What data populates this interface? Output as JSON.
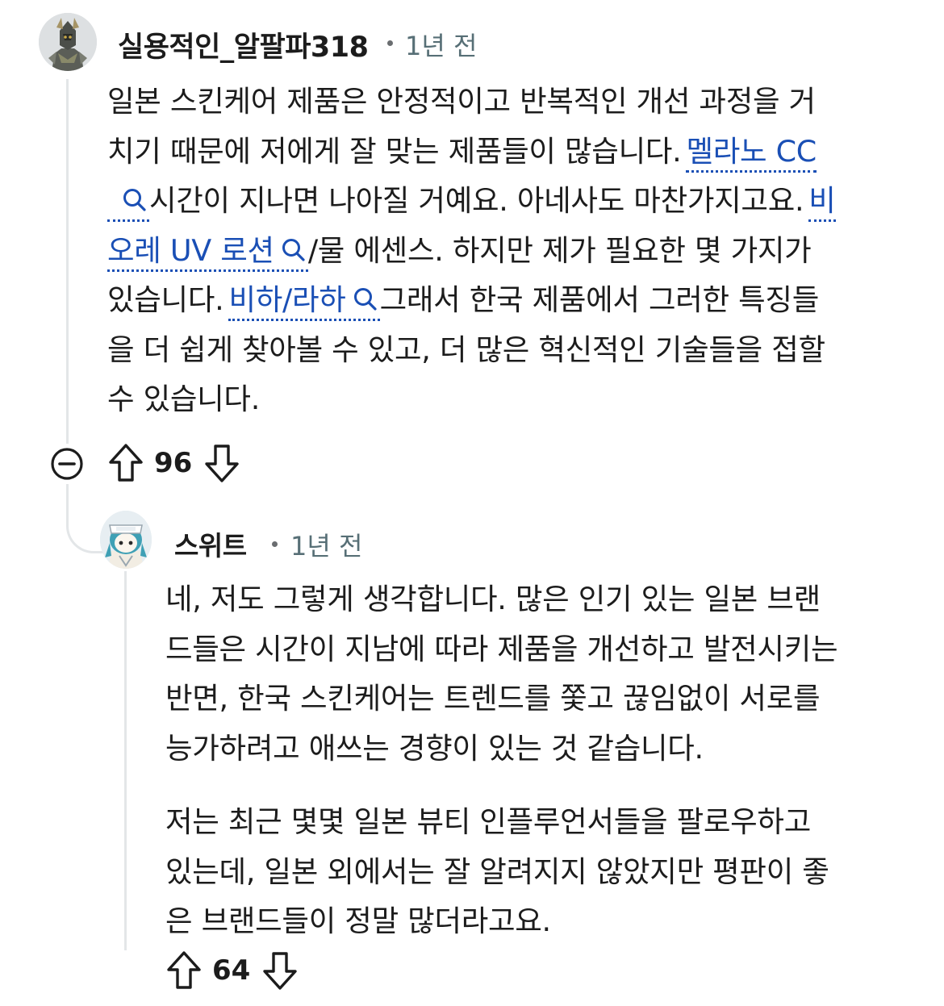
{
  "comments": [
    {
      "username": "실용적인_알팔파318",
      "time": "1년 전",
      "votes": "96",
      "lines": {
        "l1": "일본 스킨케어 제품은 안정적이고 반복적인 개선 과정을 거",
        "l2a": "치기 때문에 저에게 잘 맞는 제품들이 많습니다.",
        "l2b": "멜라노 CC",
        "l3a": "시간이 지나면 나아질 거예요. 아네사도 마찬가지고요.",
        "l3b": "비",
        "l4a": "오레 UV 로션",
        "l4b": "/물 에센스. 하지만 제가 필요한 몇 가지가",
        "l5a": "있습니다.",
        "l5b": "비하/라하",
        "l5c": "그래서 한국 제품에서 그러한 특징들",
        "l6": "을 더 쉽게 찾아볼 수 있고, 더 많은 혁신적인 기술들을 접할",
        "l7": "수 있습니다."
      }
    },
    {
      "username": "스위트",
      "time": "1년 전",
      "votes": "64",
      "lines": {
        "l1": "네, 저도 그렇게 생각합니다. 많은 인기 있는 일본 브랜",
        "l2": "드들은 시간이 지남에 따라 제품을 개선하고 발전시키는",
        "l3": "반면, 한국 스킨케어는 트렌드를 쫓고 끊임없이 서로를",
        "l4": "능가하려고 애쓰는 경향이 있는 것 같습니다.",
        "l5": "저는 최근 몇몇 일본 뷰티 인플루언서들을 팔로우하고",
        "l6": "있는데, 일본 외에서는 잘 알려지지 않았지만 평판이 좋",
        "l7": "은 브랜드들이 정말 많더라고요."
      }
    }
  ],
  "colors": {
    "link": "#1a4fb5",
    "meta": "#576f76",
    "thread": "#e3e6e8"
  }
}
